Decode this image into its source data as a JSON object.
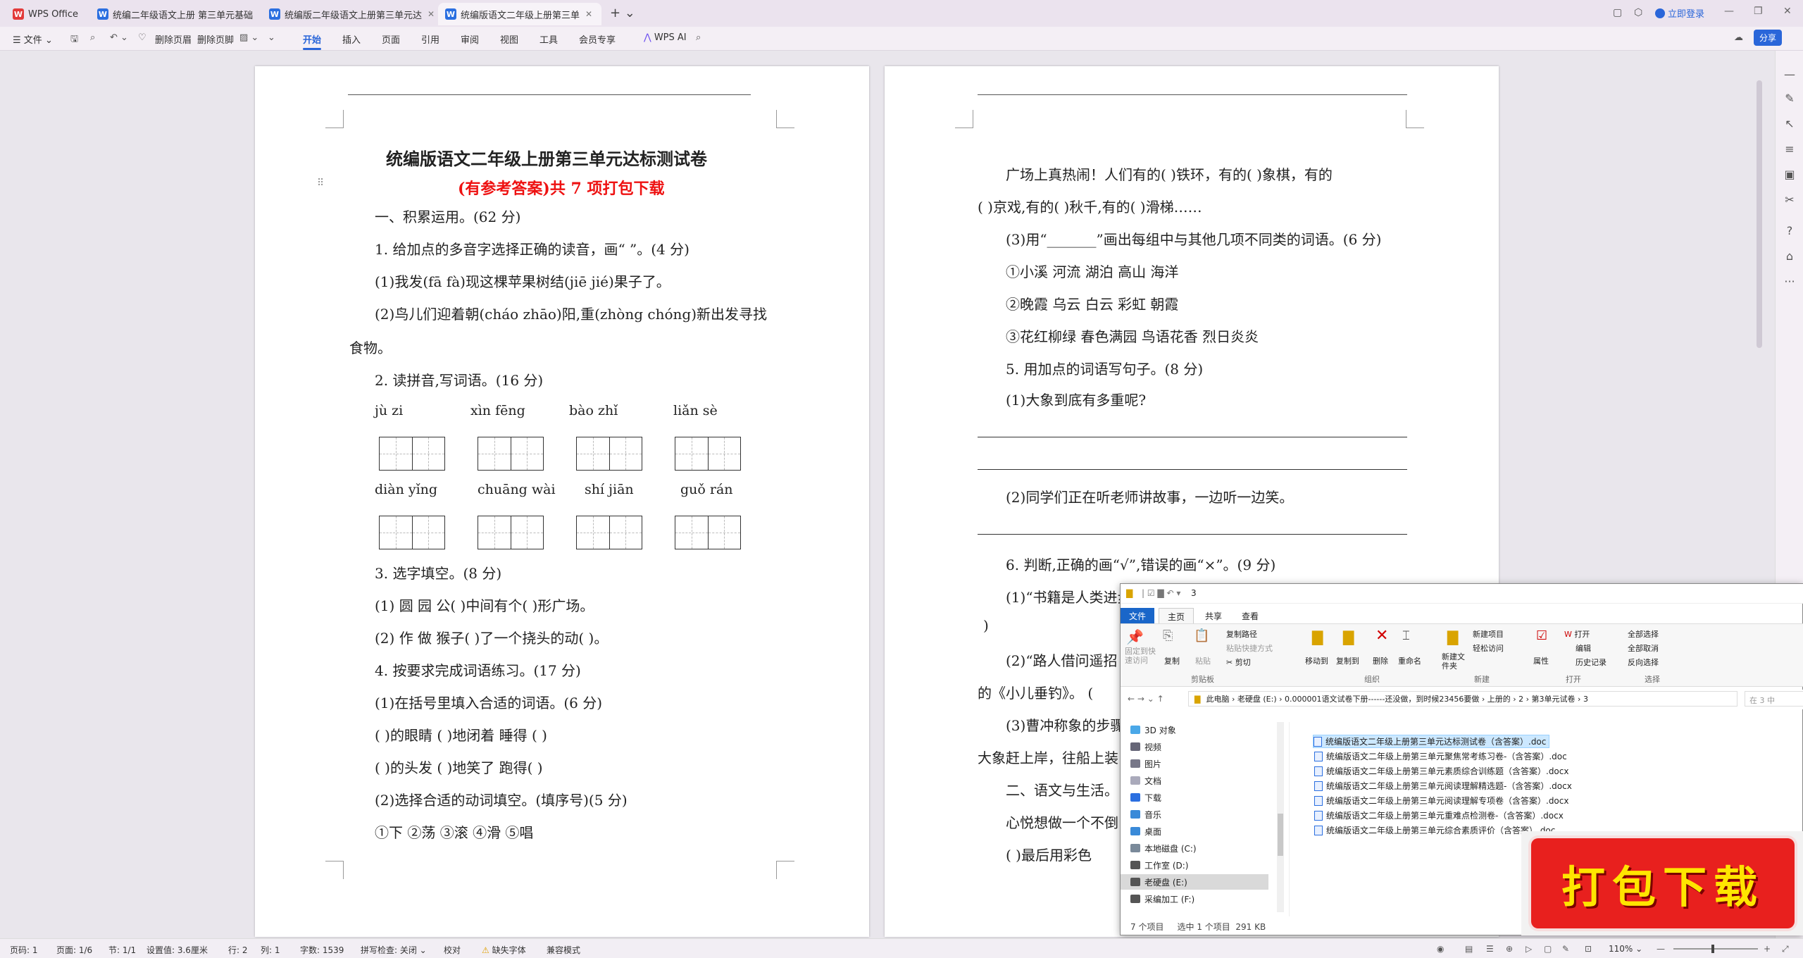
{
  "tabs": [
    {
      "label": "WPS Office"
    },
    {
      "label": "统编二年级语文上册 第三单元基础"
    },
    {
      "label": "统编版二年级语文上册第三单元达"
    },
    {
      "label": "统编版语文二年级上册第三单"
    }
  ],
  "titlebar": {
    "login": "立即登录"
  },
  "ribbon": {
    "file": "文件",
    "delete_header": "删除页眉",
    "delete_footer": "删除页脚",
    "tabs": [
      "开始",
      "插入",
      "页面",
      "引用",
      "审阅",
      "视图",
      "工具",
      "会员专享"
    ],
    "wps_ai": "WPS AI",
    "share": "分享"
  },
  "page1": {
    "title": "统编版语文二年级上册第三单元达标测试卷",
    "subtitle": "(有参考答案)共 7 项打包下载",
    "lines": [
      "一、积累运用。(62 分)",
      "1.  给加点的多音字选择正确的读音，画“ ”。(4 分)",
      "(1)我发(fā  fà)现这棵苹果树结(jiē  jié)果子了。",
      "(2)鸟儿们迎着朝(cháo  zhāo)阳,重(zhòng  chóng)新出发寻找",
      "食物。",
      "2.  读拼音,写词语。(16 分)",
      "3.  选字填空。(8 分)",
      "(1)    圆    园    公(        )中间有个(        )形广场。",
      "(2)    作    做    猴子(        )了一个挠头的动(        )。",
      "4.  按要求完成词语练习。(17 分)",
      "(1)在括号里填入合适的词语。(6 分)",
      "(        )的眼睛      (        )地闭着      睡得 (        )",
      "(        )的头发      (        )地笑了      跑得(        )",
      "(2)选择合适的动词填空。(填序号)(5 分)",
      "①下    ②荡    ③滚    ④滑    ⑤唱"
    ],
    "pinyin_row1": [
      "jù  zi",
      "xìn  fēng",
      "bào  zhǐ",
      "liǎn  sè"
    ],
    "pinyin_row2": [
      "diàn  yǐng",
      "chuāng  wài",
      "shí  jiān",
      "guǒ  rán"
    ]
  },
  "page2": {
    "lines": [
      "广场上真热闹！人们有的(        )铁环，有的(        )象棋，有的",
      "(        )京戏,有的(        )秋千,有的(        )滑梯……",
      "(3)用“_______”画出每组中与其他几项不同类的词语。(6 分)",
      "①小溪             河流             湖泊             高山          海洋",
      "②晚霞             乌云             白云             彩虹          朝霞",
      "③花红柳绿       春色满园       鸟语花香       烈日炎炎",
      "5.  用加点的词语写句子。(8 分)",
      "(1)大象到底有多重呢?",
      "(2)同学们正在听老师讲故事，一边听一边笑。",
      "6.  判断,正确的画“√”,错误的画“×”。(9 分)",
      "(1)“书籍是人类进步的阶梯。”这句名言适合挂在餐厅。(",
      ")",
      "(2)“路人借问遥招",
      "的《小儿垂钓》。    (",
      "(3)曹冲称象的步骤",
      "大象赶上岸，往船上装",
      "二、语文与生活。",
      "心悦想做一个不倒",
      "(        )最后用彩色"
    ]
  },
  "explorer": {
    "title": "3",
    "ribbon_tabs": [
      "文件",
      "主页",
      "共享",
      "查看"
    ],
    "commands": [
      "固定到快速访问",
      "复制",
      "粘贴",
      "复制路径",
      "粘贴快捷方式",
      "剪切",
      "移动到",
      "复制到",
      "删除",
      "重命名",
      "新建文件夹",
      "新建项目",
      "轻松访问",
      "属性",
      "打开",
      "编辑",
      "历史记录",
      "全部选择",
      "全部取消",
      "反向选择"
    ],
    "groups": [
      "剪贴板",
      "组织",
      "新建",
      "打开",
      "选择"
    ],
    "breadcrumb": [
      "此电脑",
      "老硬盘 (E:)",
      "0.000001语文试卷下册------还没做，到时候23456要做",
      "上册的",
      "2",
      "第3单元试卷",
      "3"
    ],
    "search_placeholder": "在 3 中",
    "nav": [
      "3D 对象",
      "视频",
      "图片",
      "文档",
      "下载",
      "音乐",
      "桌面",
      "本地磁盘 (C:)",
      "工作室 (D:)",
      "老硬盘 (E:)",
      "采编加工 (F:)"
    ],
    "files": [
      "统编版语文二年级上册第三单元达标测试卷（含答案）.doc",
      "统编版语文二年级上册第三单元聚焦常考练习卷-（含答案）.doc",
      "统编版语文二年级上册第三单元素质综合训练题（含答案）.docx",
      "统编版语文二年级上册第三单元阅读理解精选题-（含答案）.docx",
      "统编版语文二年级上册第三单元阅读理解专项卷（含答案）.docx",
      "统编版语文二年级上册第三单元重难点检测卷-（含答案）.docx",
      "统编版语文二年级上册第三单元综合素质评价（含答案）.doc"
    ],
    "status": "7 个项目     选中 1 个项目  291 KB"
  },
  "badge": "打包下载",
  "statusbar": {
    "page": "页码: 1",
    "pages": "页面: 1/6",
    "section": "节: 1/1",
    "setting": "设置值: 3.6厘米",
    "row": "行: 2",
    "col": "列: 1",
    "words": "字数: 1539",
    "spell": "拼写检查: 关闭",
    "proof": "校对",
    "missing_font": "缺失字体",
    "compat": "兼容模式",
    "zoom": "110%"
  },
  "colors": {
    "accent": "#2a66d9",
    "red": "#e11",
    "badge": "#e8201e"
  }
}
